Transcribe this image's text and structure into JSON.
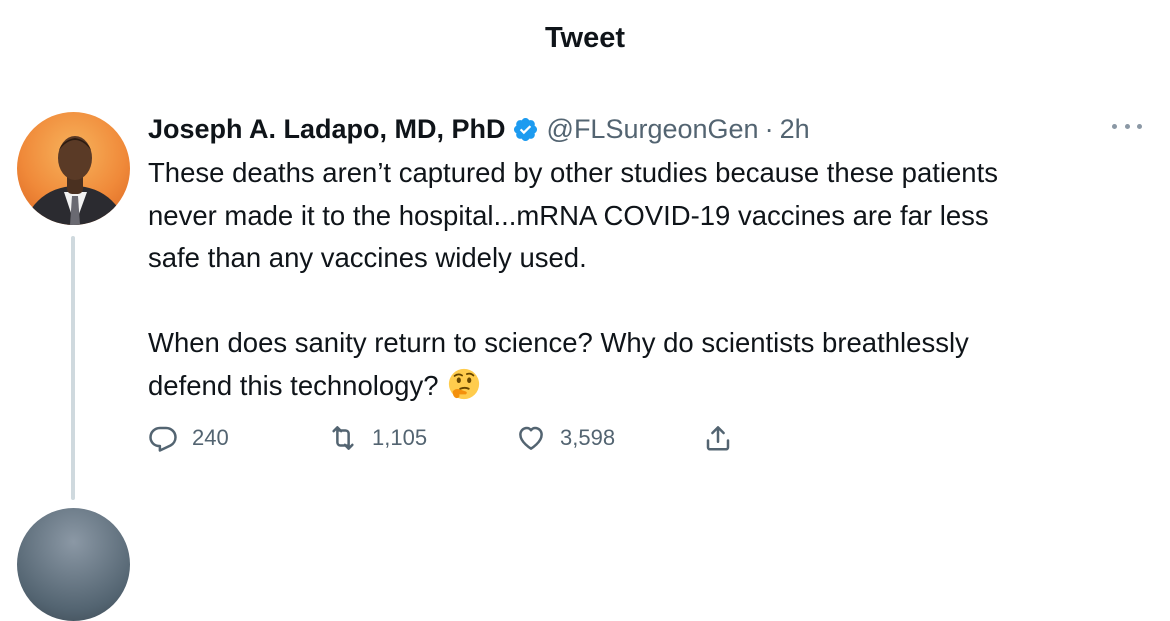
{
  "header": {
    "title": "Tweet"
  },
  "tweet": {
    "author_name": "Joseph A. Ladapo, MD, PhD",
    "handle": "@FLSurgeonGen",
    "separator": "·",
    "time": "2h",
    "verified_icon": "verified-badge-icon",
    "more_icon": "more-options-icon",
    "text_paragraph_1": "These deaths aren’t captured by other studies because these patients\nnever made it to the hospital...mRNA COVID-19 vaccines are far less\nsafe than any vaccines widely used.",
    "text_paragraph_2": "When does sanity return to science? Why do scientists breathlessly\ndefend this technology?",
    "emoji": "thinking-face-emoji",
    "actions": {
      "reply": {
        "icon": "reply-icon",
        "count": "240"
      },
      "retweet": {
        "icon": "retweet-icon",
        "count": "1,105"
      },
      "like": {
        "icon": "heart-icon",
        "count": "3,598"
      },
      "share": {
        "icon": "share-icon"
      }
    }
  },
  "colors": {
    "text": "#0f1419",
    "secondary": "#536471",
    "verified": "#1d9bf0",
    "thread_line": "#cfd9de"
  }
}
